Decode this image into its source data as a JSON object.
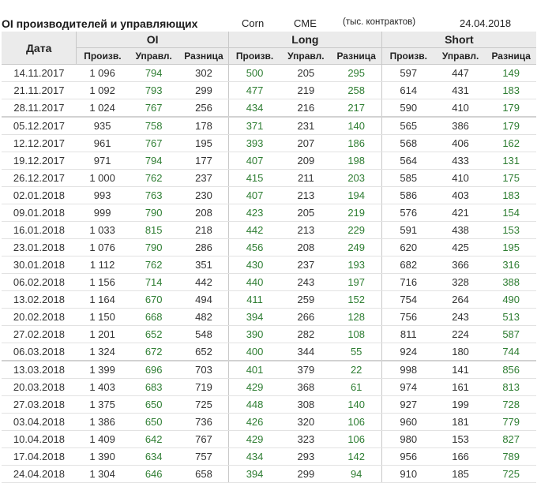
{
  "header": {
    "title": "OI производителей и управляющих",
    "symbol": "Corn",
    "exchange": "CME",
    "unit": "(тыс. контрактов)",
    "date": "24.04.2018"
  },
  "table": {
    "date_header": "Дата",
    "groups": [
      "OI",
      "Long",
      "Short"
    ],
    "subheaders": [
      "Произв.",
      "Управл.",
      "Разница",
      "Произв.",
      "Управл.",
      "Разница",
      "Произв.",
      "Управл.",
      "Разница"
    ],
    "rows": [
      {
        "date": "14.11.2017",
        "cells": [
          "1 096",
          "794",
          "302",
          "500",
          "205",
          "295",
          "597",
          "447",
          "149"
        ]
      },
      {
        "date": "21.11.2017",
        "cells": [
          "1 092",
          "793",
          "299",
          "477",
          "219",
          "258",
          "614",
          "431",
          "183"
        ]
      },
      {
        "date": "28.11.2017",
        "cells": [
          "1 024",
          "767",
          "256",
          "434",
          "216",
          "217",
          "590",
          "410",
          "179"
        ]
      },
      {
        "date": "05.12.2017",
        "cells": [
          "935",
          "758",
          "178",
          "371",
          "231",
          "140",
          "565",
          "386",
          "179"
        ]
      },
      {
        "date": "12.12.2017",
        "cells": [
          "961",
          "767",
          "195",
          "393",
          "207",
          "186",
          "568",
          "406",
          "162"
        ]
      },
      {
        "date": "19.12.2017",
        "cells": [
          "971",
          "794",
          "177",
          "407",
          "209",
          "198",
          "564",
          "433",
          "131"
        ]
      },
      {
        "date": "26.12.2017",
        "cells": [
          "1 000",
          "762",
          "237",
          "415",
          "211",
          "203",
          "585",
          "410",
          "175"
        ]
      },
      {
        "date": "02.01.2018",
        "cells": [
          "993",
          "763",
          "230",
          "407",
          "213",
          "194",
          "586",
          "403",
          "183"
        ]
      },
      {
        "date": "09.01.2018",
        "cells": [
          "999",
          "790",
          "208",
          "423",
          "205",
          "219",
          "576",
          "421",
          "154"
        ]
      },
      {
        "date": "16.01.2018",
        "cells": [
          "1 033",
          "815",
          "218",
          "442",
          "213",
          "229",
          "591",
          "438",
          "153"
        ]
      },
      {
        "date": "23.01.2018",
        "cells": [
          "1 076",
          "790",
          "286",
          "456",
          "208",
          "249",
          "620",
          "425",
          "195"
        ]
      },
      {
        "date": "30.01.2018",
        "cells": [
          "1 112",
          "762",
          "351",
          "430",
          "237",
          "193",
          "682",
          "366",
          "316"
        ]
      },
      {
        "date": "06.02.2018",
        "cells": [
          "1 156",
          "714",
          "442",
          "440",
          "243",
          "197",
          "716",
          "328",
          "388"
        ]
      },
      {
        "date": "13.02.2018",
        "cells": [
          "1 164",
          "670",
          "494",
          "411",
          "259",
          "152",
          "754",
          "264",
          "490"
        ]
      },
      {
        "date": "20.02.2018",
        "cells": [
          "1 150",
          "668",
          "482",
          "394",
          "266",
          "128",
          "756",
          "243",
          "513"
        ]
      },
      {
        "date": "27.02.2018",
        "cells": [
          "1 201",
          "652",
          "548",
          "390",
          "282",
          "108",
          "811",
          "224",
          "587"
        ]
      },
      {
        "date": "06.03.2018",
        "cells": [
          "1 324",
          "672",
          "652",
          "400",
          "344",
          "55",
          "924",
          "180",
          "744"
        ]
      },
      {
        "date": "13.03.2018",
        "cells": [
          "1 399",
          "696",
          "703",
          "401",
          "379",
          "22",
          "998",
          "141",
          "856"
        ]
      },
      {
        "date": "20.03.2018",
        "cells": [
          "1 403",
          "683",
          "719",
          "429",
          "368",
          "61",
          "974",
          "161",
          "813"
        ]
      },
      {
        "date": "27.03.2018",
        "cells": [
          "1 375",
          "650",
          "725",
          "448",
          "308",
          "140",
          "927",
          "199",
          "728"
        ]
      },
      {
        "date": "03.04.2018",
        "cells": [
          "1 386",
          "650",
          "736",
          "426",
          "320",
          "106",
          "960",
          "181",
          "779"
        ]
      },
      {
        "date": "10.04.2018",
        "cells": [
          "1 409",
          "642",
          "767",
          "429",
          "323",
          "106",
          "980",
          "153",
          "827"
        ]
      },
      {
        "date": "17.04.2018",
        "cells": [
          "1 390",
          "634",
          "757",
          "434",
          "293",
          "142",
          "956",
          "166",
          "789"
        ]
      },
      {
        "date": "24.04.2018",
        "cells": [
          "1 304",
          "646",
          "658",
          "394",
          "299",
          "94",
          "910",
          "185",
          "725"
        ]
      }
    ],
    "month_break_rows": [
      3,
      17
    ],
    "colors": {
      "header_bg": "#ebebeb",
      "highlight_text": "#2e7d32",
      "normal_text": "#333333"
    }
  }
}
